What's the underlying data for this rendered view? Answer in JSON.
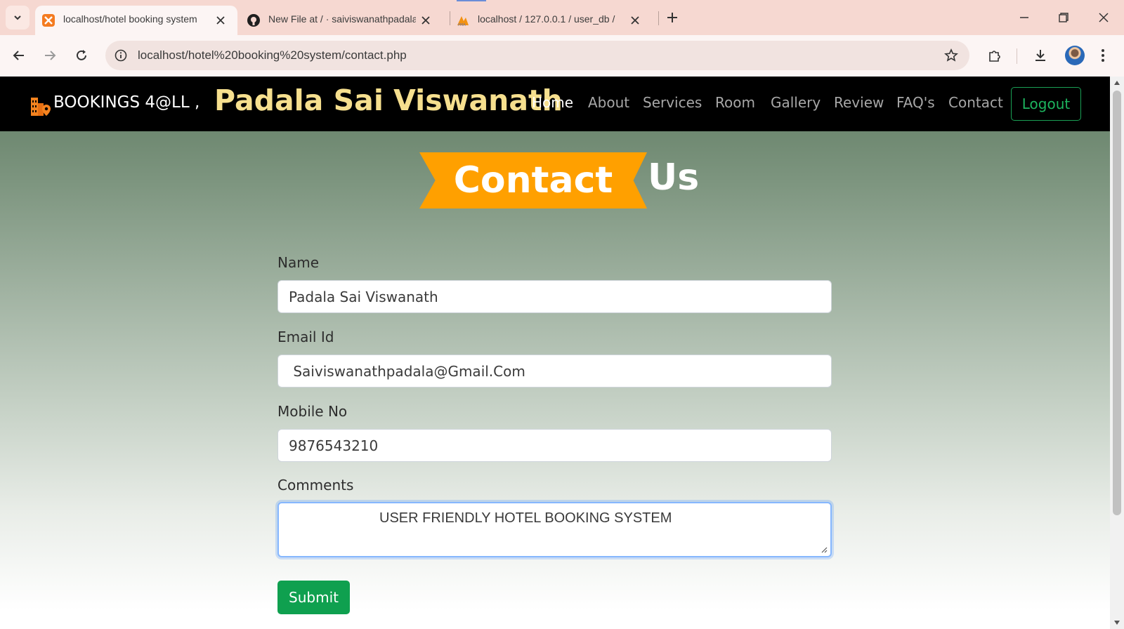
{
  "browser": {
    "tabs": [
      {
        "title": "localhost/hotel booking system",
        "active": true,
        "icon": "xampp-icon"
      },
      {
        "title": "New File at / · saiviswanathpadala",
        "active": false,
        "icon": "github-icon"
      },
      {
        "title": "localhost / 127.0.0.1 / user_db / ",
        "active": false,
        "icon": "phpmyadmin-icon"
      }
    ],
    "url": "localhost/hotel%20booking%20system/contact.php"
  },
  "navbar": {
    "brand": "BOOKINGS 4@LL ,",
    "username": "Padala Sai Viswanath",
    "items": [
      "Home",
      "About",
      "Services",
      "Room",
      "Gallery",
      "Review",
      "FAQ's",
      "Contact"
    ],
    "active_item": "Home",
    "logout_label": "Logout"
  },
  "heading": {
    "ribbon": "Contact",
    "rest": "Us"
  },
  "form": {
    "name_label": "Name",
    "name_value": "Padala Sai Viswanath",
    "email_label": "Email Id",
    "email_value": " Saiviswanathpadala@Gmail.Com",
    "mobile_label": "Mobile No",
    "mobile_value": "9876543210",
    "comments_label": "Comments",
    "comments_value": "USER FRIENDLY HOTEL BOOKING SYSTEM",
    "submit_label": "Submit"
  },
  "colors": {
    "ribbon": "#ffa000",
    "username": "#f6df8e",
    "logout": "#1db45e",
    "submit": "#0fa04f",
    "tabbar": "#f6d8d1"
  }
}
